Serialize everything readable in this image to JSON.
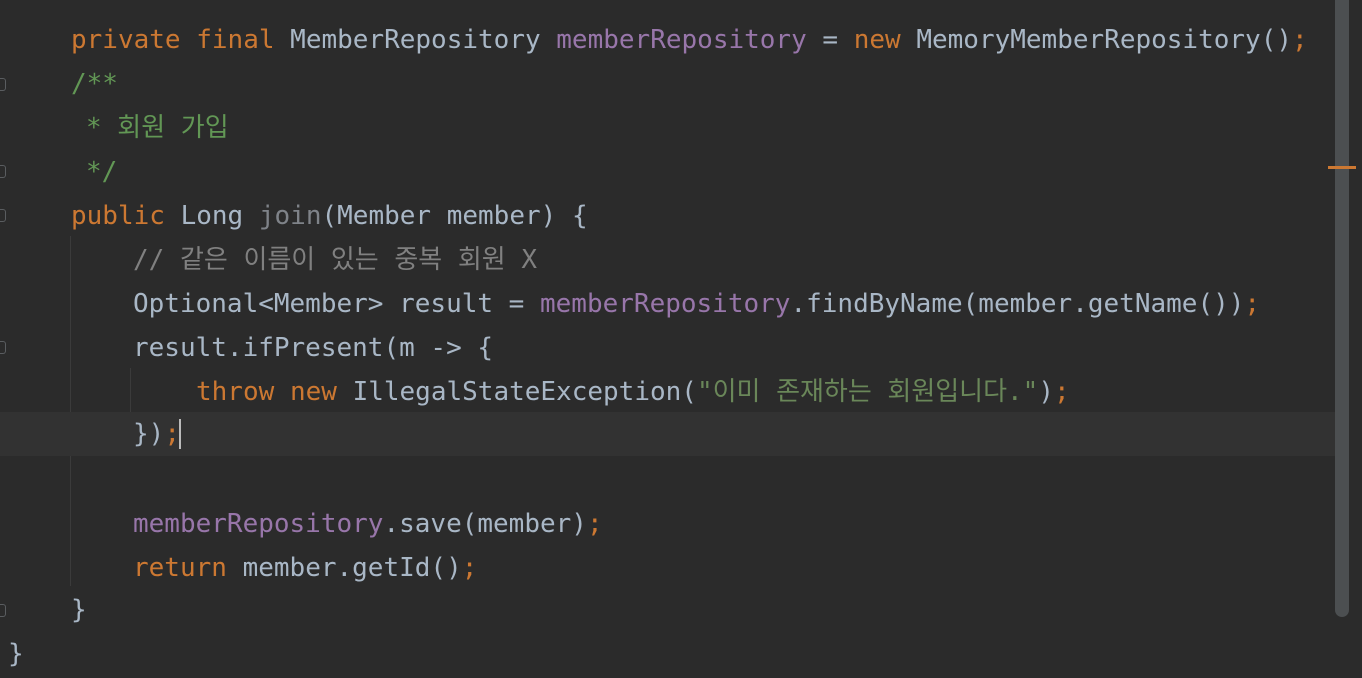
{
  "editor": {
    "language": "java",
    "lines": {
      "l1": {
        "kw1": "private",
        "kw2": "final",
        "type": "MemberRepository",
        "field": "memberRepository",
        "eq": "=",
        "kw3": "new",
        "ctor": "MemoryMemberRepository()",
        "semi": ";"
      },
      "l2": {
        "text": "/**"
      },
      "l3": {
        "text": "* 회원 가입"
      },
      "l4": {
        "text": "*/"
      },
      "l5": {
        "kw": "public",
        "type": "Long",
        "name": "join",
        "params": "(Member member) {"
      },
      "l6": {
        "text": "// 같은 이름이 있는 중복 회원 X"
      },
      "l7": {
        "decl": "Optional<Member> result =",
        "field": "memberRepository",
        "call": ".findByName(member.getName())",
        "semi": ";"
      },
      "l8": {
        "text": "result.ifPresent(m -> {"
      },
      "l9": {
        "kw1": "throw",
        "kw2": "new",
        "ctor": "IllegalStateException(",
        "str": "\"이미 존재하는 회원입니다.\"",
        "close": ")",
        "semi": ";"
      },
      "l10": {
        "close": "})",
        "semi": ";"
      },
      "l12": {
        "field": "memberRepository",
        "call": ".save(member)",
        "semi": ";"
      },
      "l13": {
        "kw": "return",
        "call": "member.getId()",
        "semi": ";"
      },
      "l14": {
        "text": "}"
      },
      "l15": {
        "text": "}"
      }
    },
    "colors": {
      "background": "#2b2b2b",
      "current_line": "#323232",
      "keyword": "#cc7832",
      "field": "#9876aa",
      "string": "#6a8759",
      "doc_comment": "#629755",
      "line_comment": "#808080",
      "default": "#a9b7c6"
    },
    "scrollbar": {
      "marker_color": "#cc7832"
    }
  }
}
